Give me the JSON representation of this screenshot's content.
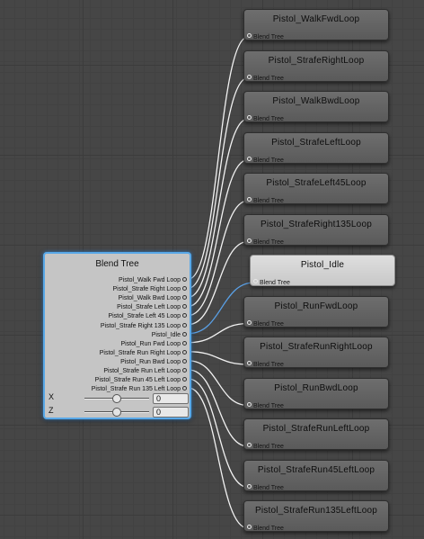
{
  "blend_tree": {
    "title": "Blend Tree",
    "outputs": [
      "Pistol_Walk Fwd Loop",
      "Pistol_Strafe Right Loop",
      "Pistol_Walk Bwd Loop",
      "Pistol_Strafe Left Loop",
      "Pistol_Strafe Left 45 Loop",
      "Pistol_Strafe Right 135 Loop",
      "Pistol_Idle",
      "Pistol_Run Fwd Loop",
      "Pistol_Strafe Run Right Loop",
      "Pistol_Run Bwd Loop",
      "Pistol_Strafe Run Left Loop",
      "Pistol_Strafe Run 45 Left Loop",
      "Pistol_Strafe Run 135 Left Loop"
    ],
    "params": [
      {
        "label": "X",
        "value": "0",
        "slider_fraction": 0.5
      },
      {
        "label": "Z",
        "value": "0",
        "slider_fraction": 0.5
      }
    ]
  },
  "motions": [
    {
      "title": "Pistol_WalkFwdLoop",
      "port": "Blend Tree",
      "selected": false
    },
    {
      "title": "Pistol_StrafeRightLoop",
      "port": "Blend Tree",
      "selected": false
    },
    {
      "title": "Pistol_WalkBwdLoop",
      "port": "Blend Tree",
      "selected": false
    },
    {
      "title": "Pistol_StrafeLeftLoop",
      "port": "Blend Tree",
      "selected": false
    },
    {
      "title": "Pistol_StrafeLeft45Loop",
      "port": "Blend Tree",
      "selected": false
    },
    {
      "title": "Pistol_StrafeRight135Loop",
      "port": "Blend Tree",
      "selected": false
    },
    {
      "title": "Pistol_Idle",
      "port": "Blend Tree",
      "selected": true
    },
    {
      "title": "Pistol_RunFwdLoop",
      "port": "Blend Tree",
      "selected": false
    },
    {
      "title": "Pistol_StrafeRunRightLoop",
      "port": "Blend Tree",
      "selected": false
    },
    {
      "title": "Pistol_RunBwdLoop",
      "port": "Blend Tree",
      "selected": false
    },
    {
      "title": "Pistol_StrafeRunLeftLoop",
      "port": "Blend Tree",
      "selected": false
    },
    {
      "title": "Pistol_StrafeRun45LeftLoop",
      "port": "Blend Tree",
      "selected": false
    },
    {
      "title": "Pistol_StrafeRun135LeftLoop",
      "port": "Blend Tree",
      "selected": false
    }
  ],
  "colors": {
    "edge": "#f2f2f2",
    "edge_selected": "#5aa0e6",
    "selection_outline": "#58a8e8"
  }
}
